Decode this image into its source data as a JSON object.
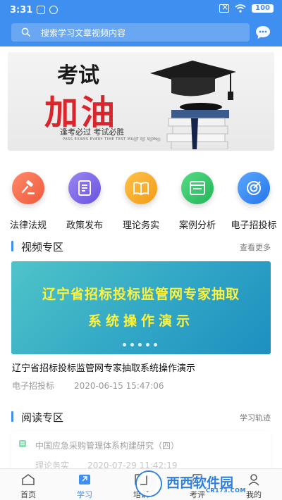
{
  "status_bar": {
    "time": "3:31",
    "battery": "100"
  },
  "search": {
    "placeholder": "搜索学习文章视频内容"
  },
  "banner": {
    "headline": "考试",
    "big_text": "加油",
    "motto": "逢考必过  考试必胜",
    "motto_en": "PASS EXAMS EVERY TIME TEST MUST BE WON"
  },
  "categories": [
    {
      "label": "法律法规",
      "icon": "gavel-icon",
      "color": "#f06a4c"
    },
    {
      "label": "政策发布",
      "icon": "document-icon",
      "color": "#7a63e6"
    },
    {
      "label": "理论务实",
      "icon": "book-icon",
      "color": "#f5a623"
    },
    {
      "label": "案例分析",
      "icon": "browser-icon",
      "color": "#34c26a"
    },
    {
      "label": "电子招投标",
      "icon": "target-icon",
      "color": "#2f86f0"
    }
  ],
  "video_section": {
    "title": "视频专区",
    "more": "查看更多",
    "card_line1": "辽宁省招标投标监管网专家抽取",
    "card_line2": "系统操作演示",
    "item_title": "辽宁省招标投标监管网专家抽取系统操作演示",
    "item_category": "电子招投标",
    "item_date": "2020-06-15 15:47:06"
  },
  "reading_section": {
    "title": "阅读专区",
    "more": "学习轨迹",
    "item_title": "中国应急采购管理体系构建研究（四）",
    "item_category": "理论务实",
    "item_date": "2020-07-29 11:42:19"
  },
  "bottom_nav": [
    {
      "label": "首页",
      "icon": "home-icon",
      "active": false
    },
    {
      "label": "学习",
      "icon": "study-icon",
      "active": true
    },
    {
      "label": "培训",
      "icon": "training-icon",
      "active": false
    },
    {
      "label": "考评",
      "icon": "exam-icon",
      "active": false
    },
    {
      "label": "我的",
      "icon": "profile-icon",
      "active": false
    }
  ],
  "watermark": {
    "text": "西西软件园",
    "sub": "CR173.COM"
  },
  "colors": {
    "primary": "#3f8ff0",
    "video_text": "#fff23a"
  }
}
